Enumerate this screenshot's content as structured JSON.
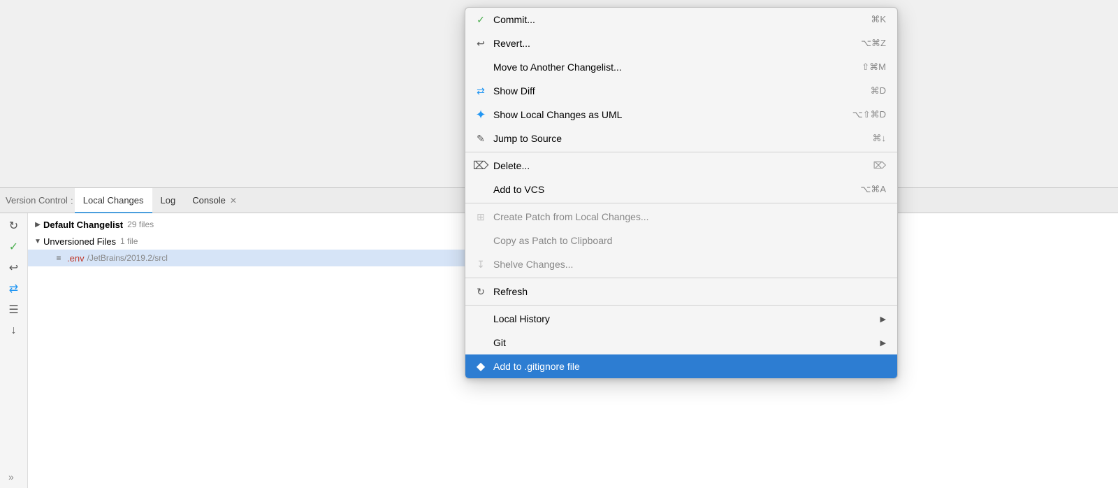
{
  "panel": {
    "title": "Version Control",
    "tabs": [
      {
        "id": "local-changes",
        "label": "Local Changes",
        "active": true
      },
      {
        "id": "log",
        "label": "Log",
        "active": false
      },
      {
        "id": "console",
        "label": "Console",
        "active": false,
        "closable": true
      }
    ]
  },
  "sidebar": {
    "icons": [
      {
        "id": "refresh",
        "symbol": "↻",
        "tooltip": "Refresh"
      },
      {
        "id": "commit",
        "symbol": "✓",
        "tooltip": "Commit",
        "class": "green"
      },
      {
        "id": "revert",
        "symbol": "↩",
        "tooltip": "Revert"
      },
      {
        "id": "diff",
        "symbol": "⇄",
        "tooltip": "Show Diff",
        "class": "blue"
      },
      {
        "id": "shelve",
        "symbol": "☰",
        "tooltip": "Shelve"
      },
      {
        "id": "download",
        "symbol": "↓",
        "tooltip": "Update"
      }
    ]
  },
  "filetree": {
    "items": [
      {
        "id": "default-changelist",
        "indent": 0,
        "triangle": "▶",
        "bold": true,
        "name": "Default Changelist",
        "count": "29 files",
        "icon": ""
      },
      {
        "id": "unversioned-files",
        "indent": 0,
        "triangle": "▼",
        "bold": false,
        "name": "Unversioned Files",
        "count": "1 file",
        "icon": ""
      },
      {
        "id": "env-file",
        "indent": 1,
        "triangle": "",
        "bold": false,
        "name": ".env",
        "nameRed": true,
        "path": "/JetBrains/2019.2/srcl",
        "icon": "≡",
        "selected": true
      }
    ]
  },
  "context_menu": {
    "items": [
      {
        "id": "commit",
        "icon": "✓",
        "icon_class": "icon-commit",
        "label": "Commit...",
        "shortcut": "⌘K",
        "disabled": false,
        "separator_after": false
      },
      {
        "id": "revert",
        "icon": "↩",
        "icon_class": "icon-revert",
        "label": "Revert...",
        "shortcut": "⌥⌘Z",
        "disabled": false,
        "separator_after": false
      },
      {
        "id": "move-changelist",
        "icon": "",
        "icon_class": "",
        "label": "Move to Another Changelist...",
        "shortcut": "⇧⌘M",
        "disabled": false,
        "separator_after": false
      },
      {
        "id": "show-diff",
        "icon": "⇄",
        "icon_class": "icon-diff",
        "label": "Show Diff",
        "shortcut": "⌘D",
        "disabled": false,
        "separator_after": false
      },
      {
        "id": "show-uml",
        "icon": "⊕",
        "icon_class": "icon-uml",
        "label": "Show Local Changes as UML",
        "shortcut": "⌥⇧⌘D",
        "disabled": false,
        "separator_after": false
      },
      {
        "id": "jump-source",
        "icon": "✎",
        "icon_class": "icon-jump",
        "label": "Jump to Source",
        "shortcut": "⌘↓",
        "disabled": false,
        "separator_after": true
      },
      {
        "id": "delete",
        "icon": "⌫",
        "icon_class": "icon-delete",
        "label": "Delete...",
        "shortcut": "⌦",
        "disabled": false,
        "separator_after": false
      },
      {
        "id": "add-vcs",
        "icon": "",
        "icon_class": "icon-vcs",
        "label": "Add to VCS",
        "shortcut": "⌥⌘A",
        "disabled": false,
        "separator_after": true
      },
      {
        "id": "create-patch",
        "icon": "⊞",
        "icon_class": "icon-patch",
        "label": "Create Patch from Local Changes...",
        "shortcut": "",
        "disabled": true,
        "separator_after": false
      },
      {
        "id": "copy-patch",
        "icon": "",
        "icon_class": "icon-copy",
        "label": "Copy as Patch to Clipboard",
        "shortcut": "",
        "disabled": true,
        "separator_after": false
      },
      {
        "id": "shelve",
        "icon": "↧",
        "icon_class": "icon-shelve",
        "label": "Shelve Changes...",
        "shortcut": "",
        "disabled": true,
        "separator_after": true
      },
      {
        "id": "refresh",
        "icon": "↻",
        "icon_class": "icon-refresh",
        "label": "Refresh",
        "shortcut": "",
        "disabled": false,
        "separator_after": true
      },
      {
        "id": "local-history",
        "icon": "",
        "icon_class": "icon-history",
        "label": "Local History",
        "shortcut": "",
        "disabled": false,
        "submenu": true,
        "separator_after": false
      },
      {
        "id": "git",
        "icon": "",
        "icon_class": "icon-git",
        "label": "Git",
        "shortcut": "",
        "disabled": false,
        "submenu": true,
        "separator_after": false
      },
      {
        "id": "add-gitignore",
        "icon": "◆",
        "icon_class": "icon-gitignore",
        "label": "Add to .gitignore file",
        "shortcut": "",
        "disabled": false,
        "highlighted": true,
        "separator_after": false
      }
    ]
  }
}
